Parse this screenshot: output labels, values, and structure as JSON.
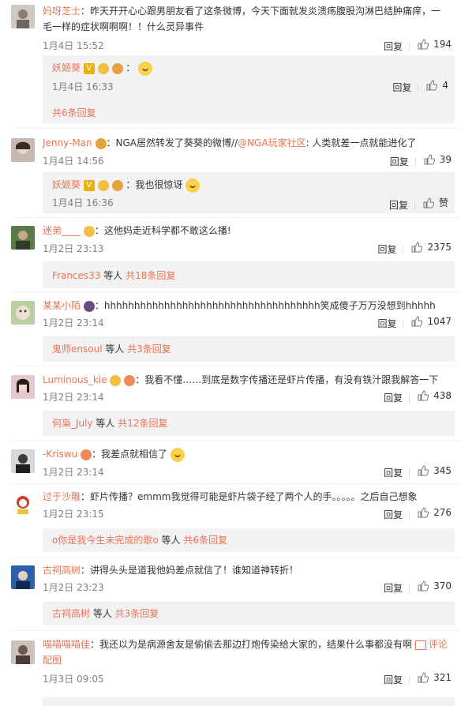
{
  "comments": [
    {
      "user": "妈呀芝士",
      "text": "：昨天开开心心跟男朋友看了这条微博，今天下面就发炎溃疡腹股沟淋巴结肿痛痒，一毛一样的症状啊啊啊！！什么灵异事件",
      "time": "1月4日 15:52",
      "reply": "回复",
      "likes": "194",
      "sub": {
        "user": "妖姬葵",
        "text": "：",
        "time": "1月4日 16:33",
        "reply": "回复",
        "likes": "4"
      },
      "more": "共6条回复"
    },
    {
      "user": "Jenny-Man",
      "text_a": "：NGA居然转发了葵葵的微博//",
      "mention": "@NGA玩家社区",
      "text_b": ": 人类就差一点就能进化了",
      "time": "1月4日 14:56",
      "reply": "回复",
      "likes": "39",
      "sub": {
        "user": "妖姬葵",
        "text": "：我也很惊讶",
        "time": "1月4日 16:36",
        "reply": "回复",
        "likes": "赞"
      }
    },
    {
      "user": "迷弟____",
      "text": "：这他妈走近科学都不敢这么播!",
      "time": "1月2日 23:13",
      "reply": "回复",
      "likes": "2375",
      "more_who": "Frances33",
      "more_plain": " 等人 ",
      "more": "共18条回复"
    },
    {
      "user": "某某小陌",
      "text": "：hhhhhhhhhhhhhhhhhhhhhhhhhhhhhhhhhhhh笑成傻子万万没想到hhhhh",
      "time": "1月2日 23:14",
      "reply": "回复",
      "likes": "1047",
      "more_who": "鬼师ensoul",
      "more_plain": " 等人 ",
      "more": "共3条回复"
    },
    {
      "user": "Luminous_kie",
      "text": "：我看不懂……到底是数字传播还是虾片传播，有没有铁汁跟我解答一下",
      "time": "1月2日 23:14",
      "reply": "回复",
      "likes": "438",
      "more_who": "何枭_July",
      "more_plain": " 等人 ",
      "more": "共12条回复"
    },
    {
      "user": "-Kriswu",
      "text": "：我差点就相信了",
      "time": "1月2日 23:14",
      "reply": "回复",
      "likes": "345"
    },
    {
      "user": "过于沙雕",
      "text": "：虾片传播？emmm我觉得可能是虾片袋子经了两个人的手。。。。。之后自己想象",
      "time": "1月2日 23:15",
      "reply": "回复",
      "likes": "276",
      "more_who": "o你是我今生未完成的歌o",
      "more_plain": " 等人 ",
      "more": "共6条回复"
    },
    {
      "user": "古祠高树",
      "text": "：讲得头头是道我他妈差点就信了！谁知道神转折！",
      "time": "1月2日 23:23",
      "reply": "回复",
      "likes": "370",
      "more_who": "古祠高树",
      "more_plain": " 等人 ",
      "more": "共3条回复"
    },
    {
      "user": "喵喵喵喵佳",
      "text": "：我还以为是病源舍友是偷偷去那边打炮传染给大家的，结果什么事都没有啊",
      "pic": "评论配图",
      "time": "1月3日 09:05",
      "reply": "回复",
      "likes": "321"
    }
  ],
  "colors": {
    "link": "#eb7350",
    "subbg": "#f2f2f5"
  }
}
